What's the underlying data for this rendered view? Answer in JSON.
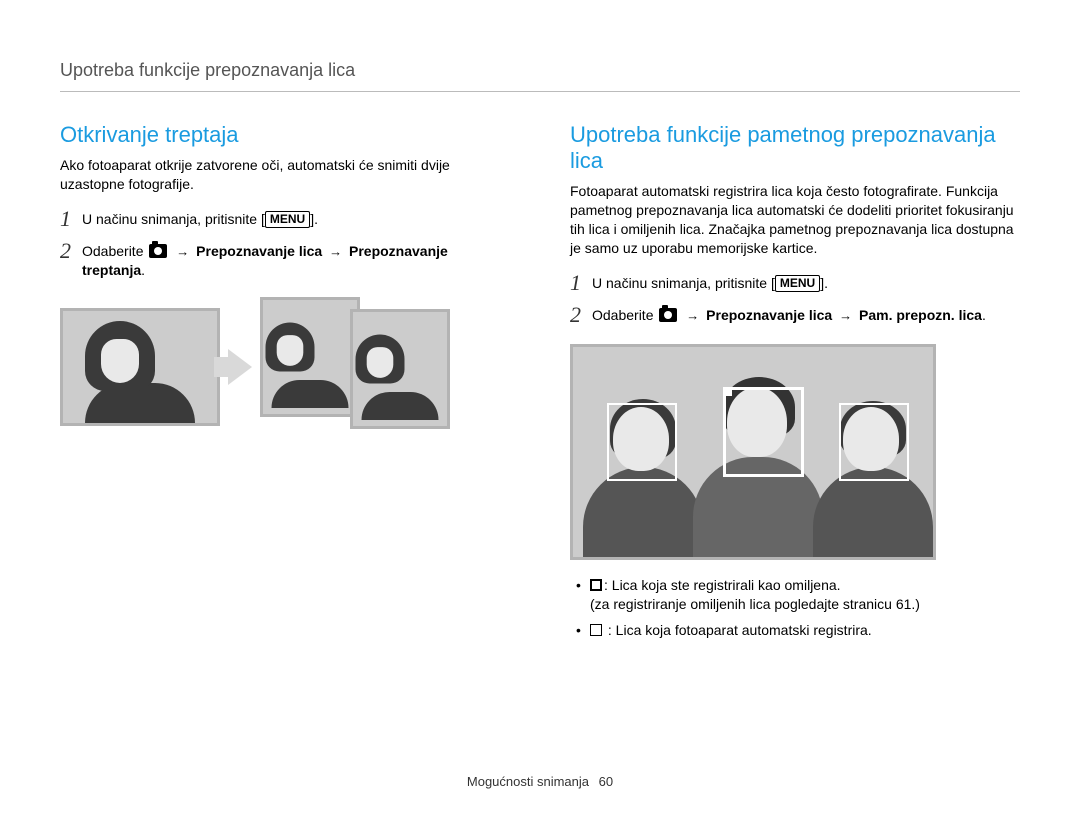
{
  "header": {
    "running_title": "Upotreba funkcije prepoznavanja lica"
  },
  "left": {
    "title": "Otkrivanje treptaja",
    "intro": "Ako fotoaparat otkrije zatvorene oči, automatski će snimiti dvije uzastopne fotografije.",
    "step1_pre": "U načinu snimanja, pritisnite [",
    "step1_menu": "MENU",
    "step1_post": "].",
    "step2_prefix": "Odaberite ",
    "step2_path_a": "Prepoznavanje lica",
    "step2_path_b": "Prepoznavanje treptanja",
    "step2_period": "."
  },
  "right": {
    "title": "Upotreba funkcije pametnog prepoznavanja lica",
    "intro": "Fotoaparat automatski registrira lica koja često fotografirate. Funkcija pametnog prepoznavanja lica automatski će dodeliti prioritet fokusiranju tih lica i omiljenih lica. Značajka pametnog prepoznavanja lica dostupna je samo uz uporabu memorijske kartice.",
    "step1_pre": "U načinu snimanja, pritisnite [",
    "step1_menu": "MENU",
    "step1_post": "].",
    "step2_prefix": "Odaberite ",
    "step2_path_a": "Prepoznavanje lica",
    "step2_path_b": "Pam. prepozn. lica",
    "step2_period": ".",
    "bullet1_colon": ": ",
    "bullet1_text": "Lica koja ste registrirali kao omiljena.",
    "bullet1_sub": "(za registriranje omiljenih lica pogledajte stranicu 61.)",
    "bullet2_colon": " : ",
    "bullet2_text": "Lica koja fotoaparat automatski registrira."
  },
  "footer": {
    "section": "Mogućnosti snimanja",
    "page": "60"
  },
  "arrow": "→"
}
